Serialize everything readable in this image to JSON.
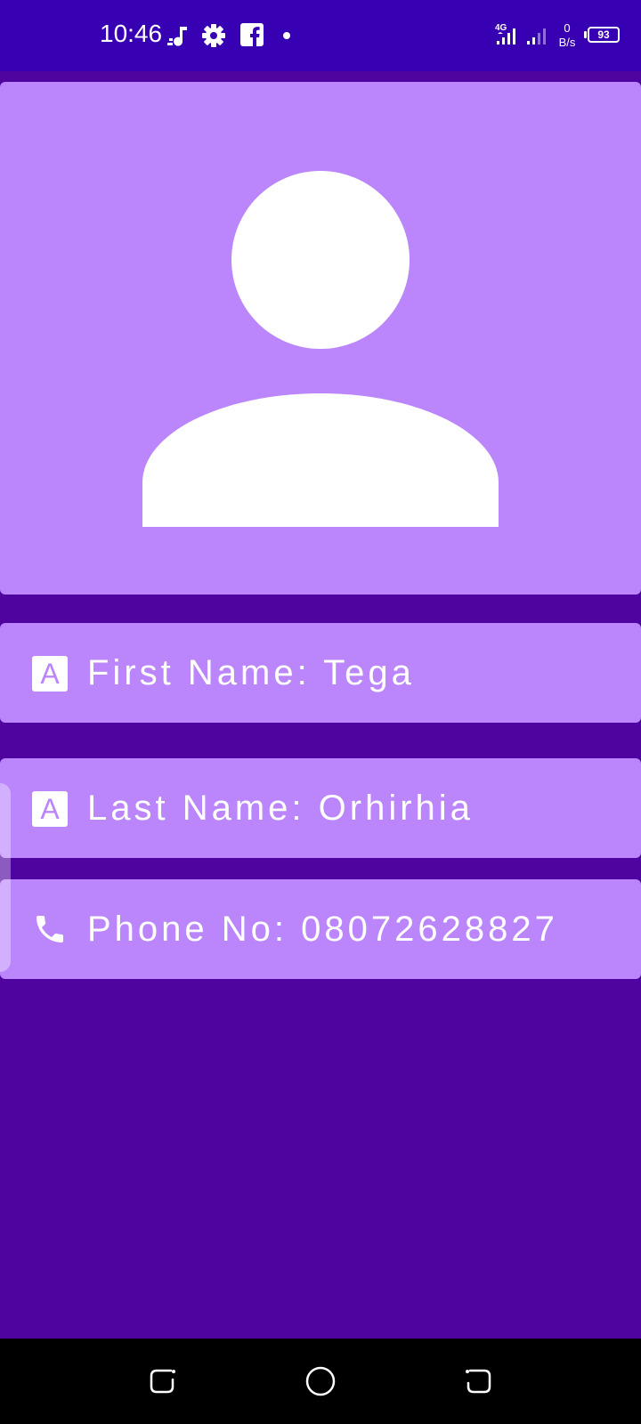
{
  "status_bar": {
    "time": "10:46",
    "network_type": "4G",
    "net_rate_value": "0",
    "net_rate_unit": "B/s",
    "battery_level": "93",
    "icons": [
      "music-note-icon",
      "gear-icon",
      "facebook-icon",
      "notification-dot-icon",
      "signal-icon",
      "battery-icon"
    ]
  },
  "profile": {
    "avatar_icon": "person-icon",
    "rows": [
      {
        "icon": "letter-a-icon",
        "icon_letter": "A",
        "text": "First Name: Tega"
      },
      {
        "icon": "letter-a-icon",
        "icon_letter": "A",
        "text": "Last Name: Orhirhia"
      },
      {
        "icon": "phone-icon",
        "text": "Phone No: 08072628827"
      }
    ]
  },
  "nav_bar": {
    "buttons": [
      "recents-button",
      "home-button",
      "back-button"
    ]
  },
  "colors": {
    "status_bar": "#3700b3",
    "background": "#4f049f",
    "card": "#bb86fc",
    "text": "#ffffff"
  }
}
